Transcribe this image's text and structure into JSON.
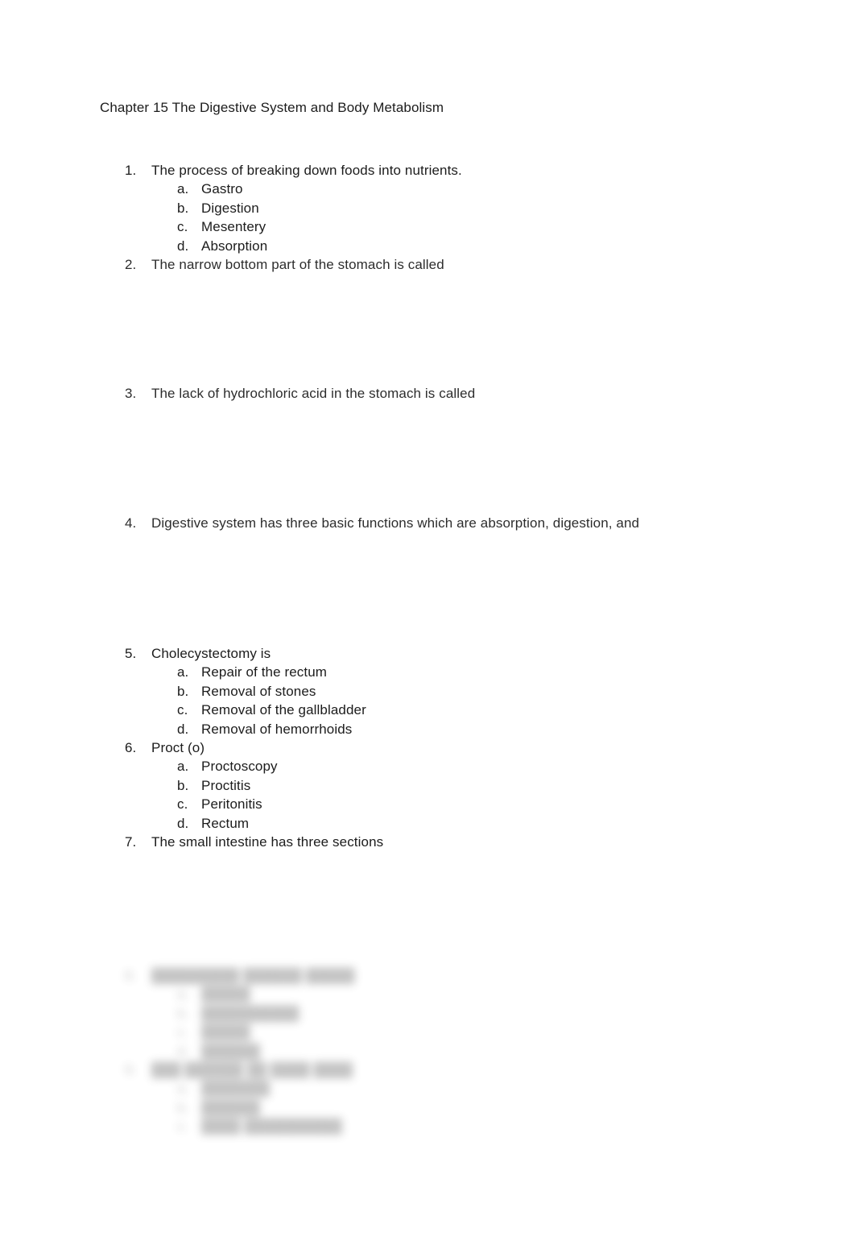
{
  "document": {
    "title": "Chapter 15 The Digestive System and Body Metabolism",
    "background_color": "#ffffff",
    "text_color": "#1c1c1c"
  },
  "questions": [
    {
      "number": "1.",
      "text": "The process of breaking down foods into nutrients.",
      "options": [
        {
          "letter": "a.",
          "text": "Gastro"
        },
        {
          "letter": "b.",
          "text": "Digestion"
        },
        {
          "letter": "c.",
          "text": "Mesentery"
        },
        {
          "letter": "d.",
          "text": "Absorption"
        }
      ]
    },
    {
      "number": "2.",
      "text": "The narrow bottom part of the stomach is called",
      "options": []
    },
    {
      "number": "3.",
      "text": "The lack of hydrochloric acid in the stomach is called",
      "options": []
    },
    {
      "number": "4.",
      "text": "Digestive system has three basic functions which are absorption, digestion, and",
      "options": []
    },
    {
      "number": "5.",
      "text": "Cholecystectomy is",
      "options": [
        {
          "letter": "a.",
          "text": "Repair of the rectum"
        },
        {
          "letter": "b.",
          "text": "Removal of stones"
        },
        {
          "letter": "c.",
          "text": "Removal of the gallbladder"
        },
        {
          "letter": "d.",
          "text": "Removal of hemorrhoids"
        }
      ]
    },
    {
      "number": "6.",
      "text": "Proct (o)",
      "options": [
        {
          "letter": "a.",
          "text": "Proctoscopy"
        },
        {
          "letter": "b.",
          "text": "Proctitis"
        },
        {
          "letter": "c.",
          "text": "Peritonitis"
        },
        {
          "letter": "d.",
          "text": "Rectum"
        }
      ]
    },
    {
      "number": "7.",
      "text": "The small intestine has three sections",
      "options": []
    }
  ],
  "redacted": {
    "note": "illegible blurred text at page bottom",
    "items": [
      {
        "number": "8.",
        "text": "█████████ ██████ █████",
        "options": [
          {
            "letter": "a.",
            "text": "█████"
          },
          {
            "letter": "b.",
            "text": "██████████"
          },
          {
            "letter": "c.",
            "text": "█████"
          },
          {
            "letter": "d.",
            "text": "██████"
          }
        ]
      },
      {
        "number": "9.",
        "text": "███ ██████ ██ ████ ████",
        "options": [
          {
            "letter": "a.",
            "text": "███████"
          },
          {
            "letter": "b.",
            "text": "██████"
          },
          {
            "letter": "c.",
            "text": "████ ██████████"
          }
        ]
      }
    ]
  }
}
